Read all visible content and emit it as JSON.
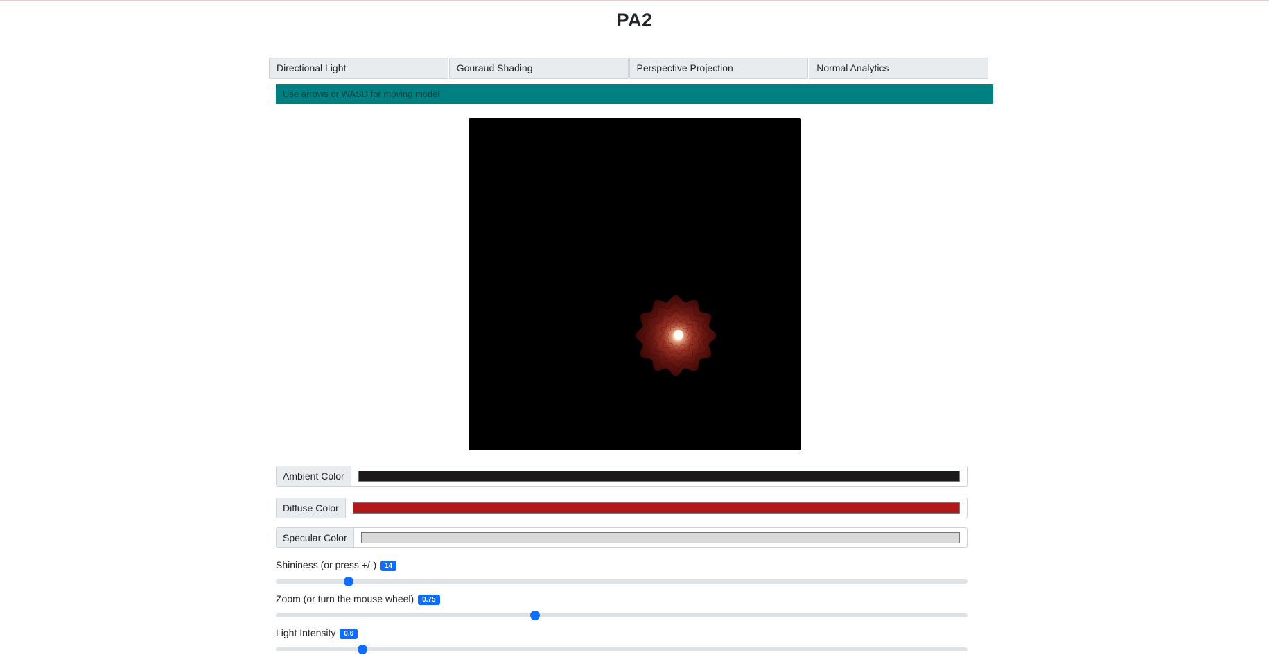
{
  "page": {
    "title": "PA2"
  },
  "tabs": [
    {
      "label": "Directional Light"
    },
    {
      "label": "Gouraud Shading"
    },
    {
      "label": "Perspective Projection"
    },
    {
      "label": "Normal Analytics"
    }
  ],
  "alert": {
    "text": "Use arrows or WASD for moving model"
  },
  "colors": {
    "ambient": {
      "label": "Ambient Color",
      "value": "#1a1a1a"
    },
    "diffuse": {
      "label": "Diffuse Color",
      "value": "#b21a1a"
    },
    "specular": {
      "label": "Specular Color",
      "value": "#d9d9d9"
    }
  },
  "sliders": {
    "shininess": {
      "label": "Shininess (or press +/-)",
      "value": "14",
      "fraction": 0.105
    },
    "zoom": {
      "label": "Zoom (or turn the mouse wheel)",
      "value": "0.75",
      "fraction": 0.375
    },
    "light_intensity": {
      "label": "Light Intensity",
      "value": "0.6",
      "fraction": 0.125
    }
  }
}
